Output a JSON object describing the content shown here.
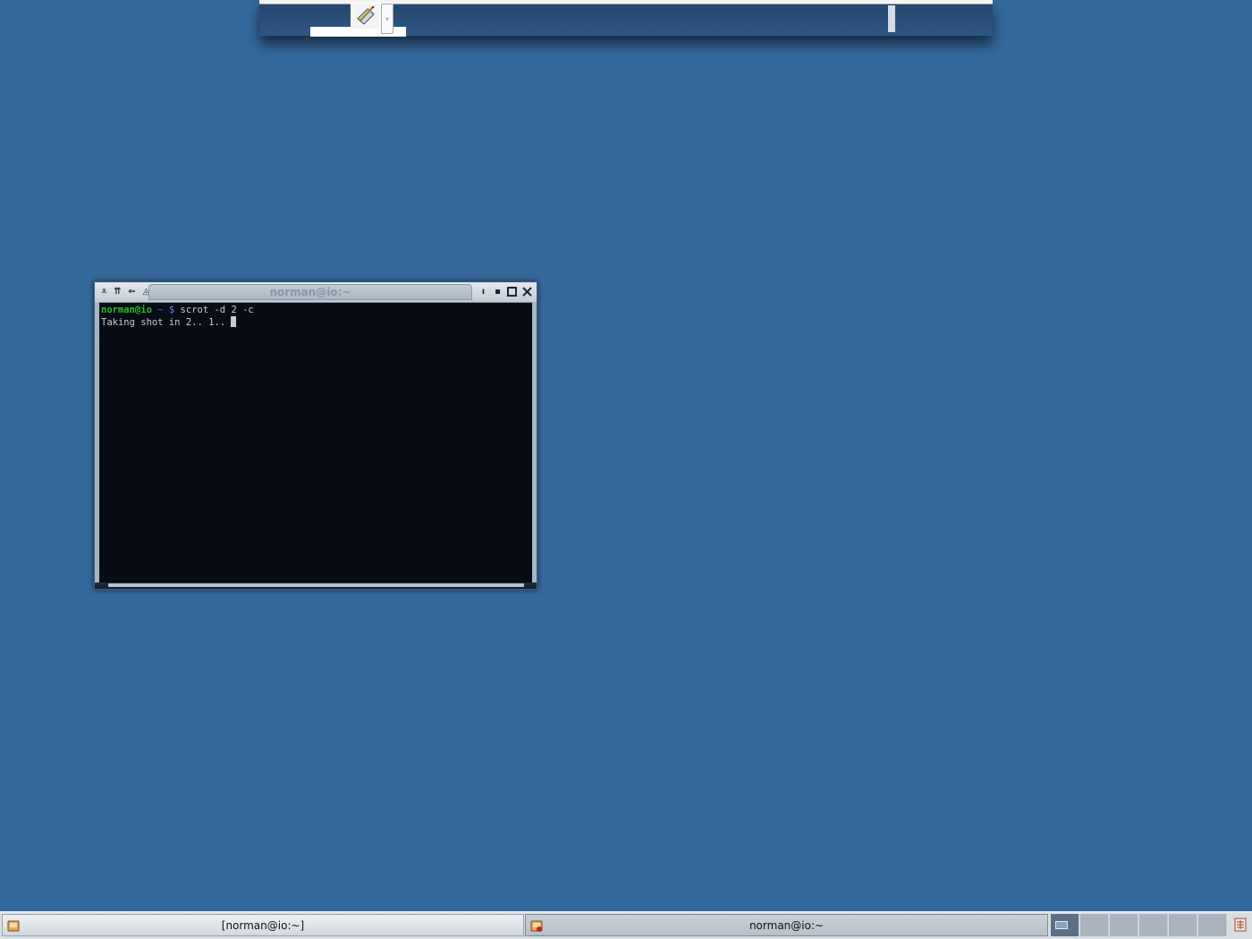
{
  "desktop": {
    "background_color": "#35689b"
  },
  "top_window": {
    "tool_icon": "draw-pencil-icon",
    "dropdown_icon": "chevron-down-icon"
  },
  "terminal": {
    "title": "norman@io:~",
    "titlebar_buttons_left": [
      "menu-icon",
      "stick-icon",
      "shade-icon",
      "layer-icon"
    ],
    "titlebar_buttons_right": [
      "minimize-icon",
      "iconify-icon",
      "maximize-icon",
      "close-icon"
    ],
    "prompt": {
      "user_host": "norman@io",
      "dir": "~",
      "symbol": "$",
      "command": "scrot -d 2 -c"
    },
    "output_line": "Taking shot in 2.. 1.."
  },
  "taskbar": {
    "tasks": [
      {
        "label": "[norman@io:~]",
        "icon": "terminal-app-icon",
        "active": false
      },
      {
        "label": "norman@io:~",
        "icon": "terminal-app-icon",
        "active": true
      }
    ],
    "pager": {
      "workspace_count": 6,
      "current": 1
    },
    "tray_icon": "keyboard-layout-icon",
    "colors": {
      "bar": "#d9dee3",
      "pager_current": "#5b6f88",
      "pager_other": "#a9b3bd"
    }
  }
}
